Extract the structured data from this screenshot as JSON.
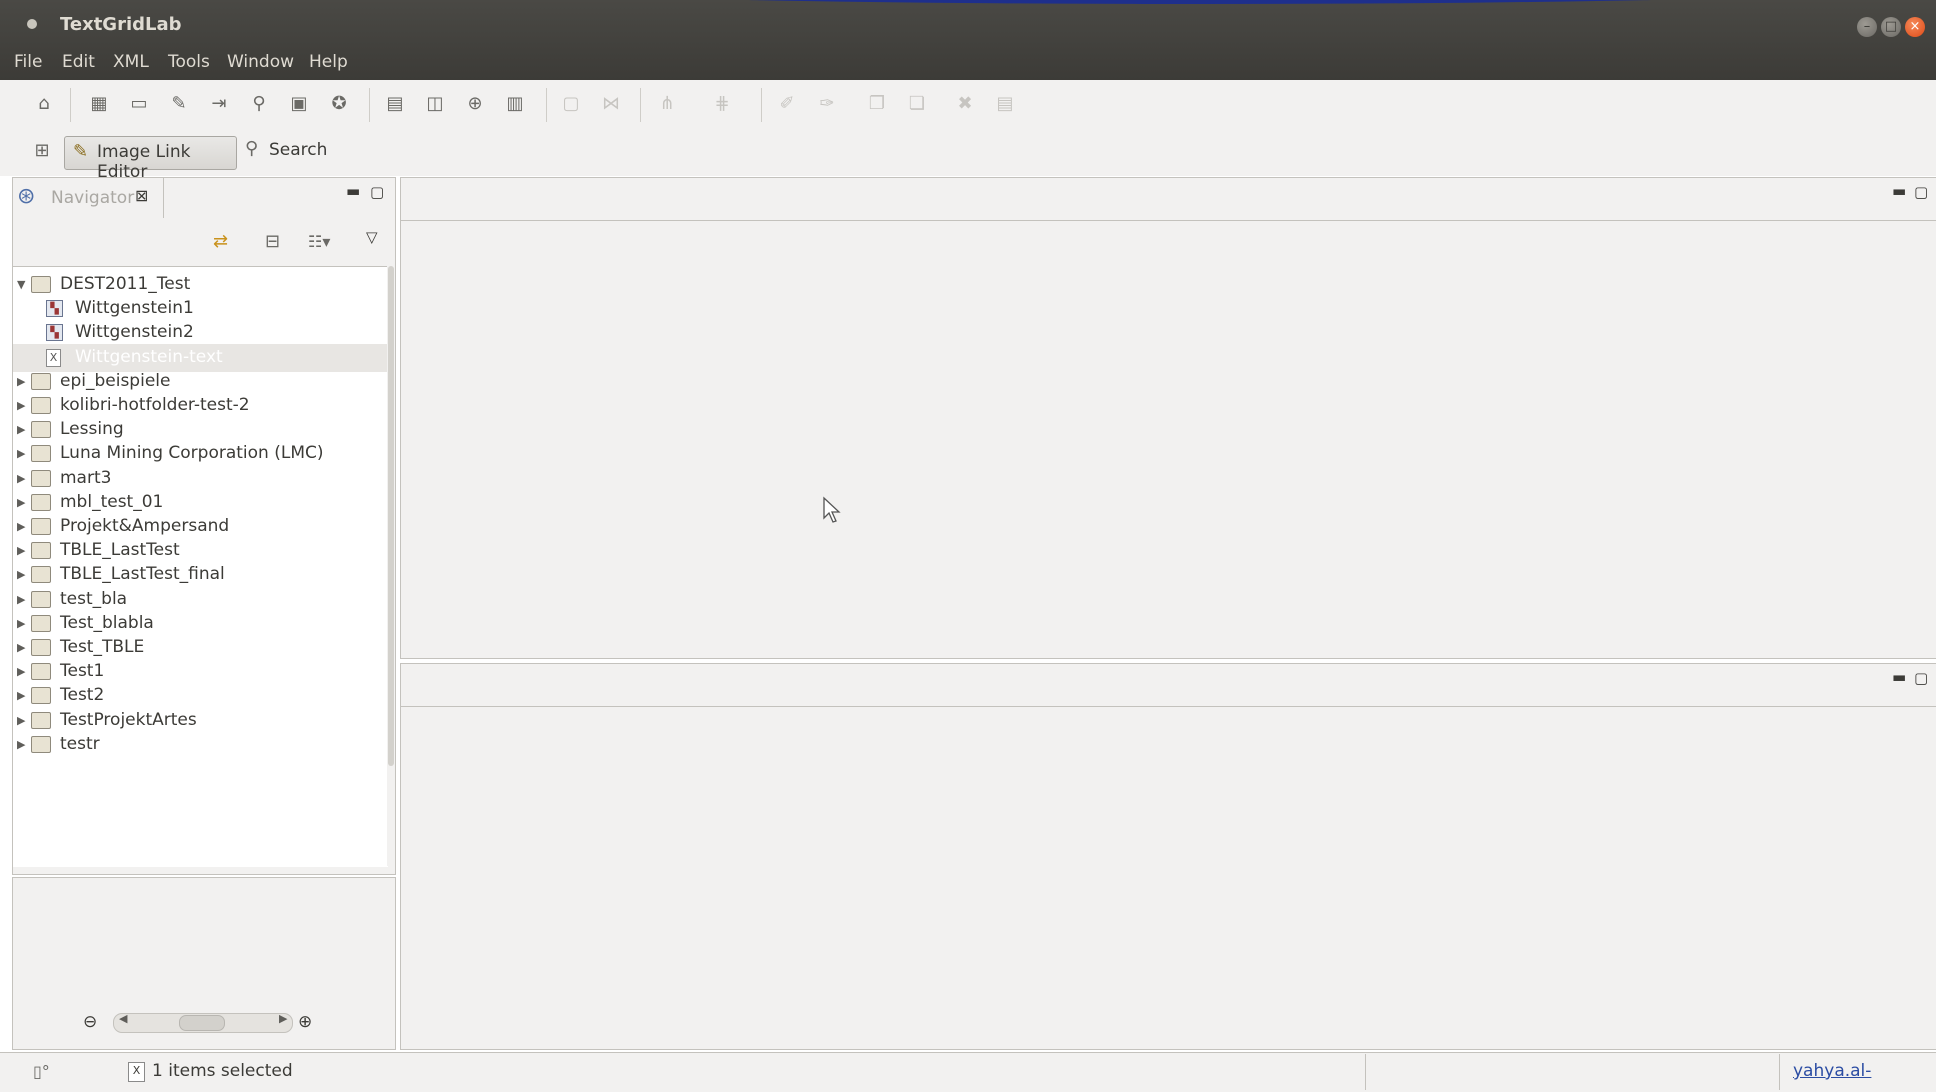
{
  "window": {
    "title": "TextGridLab"
  },
  "menu": [
    "File",
    "Edit",
    "XML",
    "Tools",
    "Window",
    "Help"
  ],
  "toolbar2": {
    "perspective_label": "Image Link Editor",
    "search_label": "Search"
  },
  "navigator": {
    "tab_label": "Navigator",
    "tree": [
      {
        "label": "DEST2011_Test",
        "type": "folder",
        "expanded": true,
        "level": 0
      },
      {
        "label": "Wittgenstein1",
        "type": "image-link",
        "level": 1
      },
      {
        "label": "Wittgenstein2",
        "type": "image-link",
        "level": 1
      },
      {
        "label": "Wittgenstein-text",
        "type": "xml",
        "level": 1,
        "selected": true
      },
      {
        "label": "epi_beispiele",
        "type": "folder",
        "level": 0
      },
      {
        "label": "kolibri-hotfolder-test-2",
        "type": "folder",
        "level": 0
      },
      {
        "label": "Lessing",
        "type": "folder",
        "level": 0
      },
      {
        "label": "Luna Mining Corporation (LMC)",
        "type": "folder",
        "level": 0
      },
      {
        "label": "mart3",
        "type": "folder",
        "level": 0
      },
      {
        "label": "mbl_test_01",
        "type": "folder",
        "level": 0
      },
      {
        "label": "Projekt&Ampersand",
        "type": "folder",
        "level": 0
      },
      {
        "label": "TBLE_LastTest",
        "type": "folder",
        "level": 0
      },
      {
        "label": "TBLE_LastTest_final",
        "type": "folder",
        "level": 0
      },
      {
        "label": "test_bla",
        "type": "folder",
        "level": 0
      },
      {
        "label": "Test_blabla",
        "type": "folder",
        "level": 0
      },
      {
        "label": "Test_TBLE",
        "type": "folder",
        "level": 0
      },
      {
        "label": "Test1",
        "type": "folder",
        "level": 0
      },
      {
        "label": "Test2",
        "type": "folder",
        "level": 0
      },
      {
        "label": "TestProjektArtes",
        "type": "folder",
        "level": 0
      },
      {
        "label": "testr",
        "type": "folder",
        "level": 0
      }
    ]
  },
  "status": {
    "selection_text": "1 items selected",
    "user": "yahya.al-"
  },
  "colors": {
    "title_bar": "#3c3b37",
    "close_button": "#df4a16",
    "link": "#2b4ca3"
  }
}
